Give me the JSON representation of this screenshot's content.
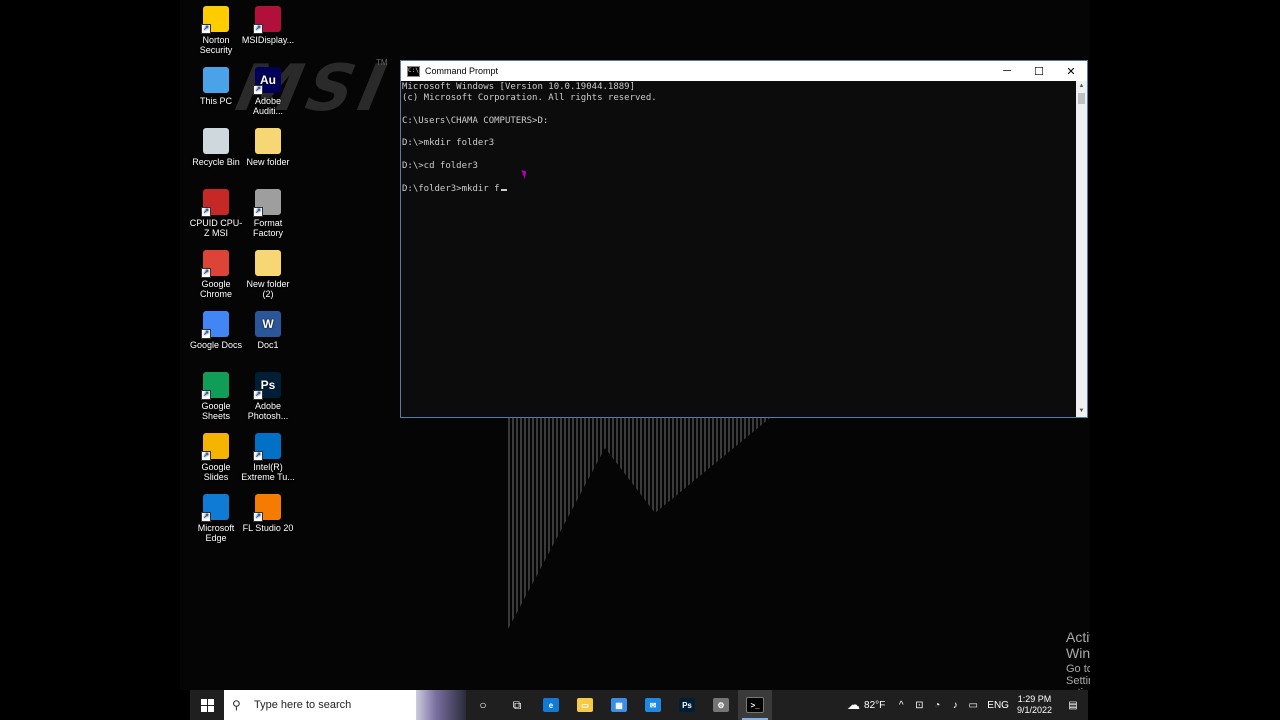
{
  "desktop": {
    "icons": [
      {
        "label": "Norton Security",
        "icon": "norton-icon",
        "color": "#ffcc00"
      },
      {
        "label": "MSIDisplay...",
        "icon": "msi-display-icon",
        "color": "#b0103a"
      },
      {
        "label": "This PC",
        "icon": "this-pc-icon",
        "color": "#4aa3e8"
      },
      {
        "label": "Adobe Auditi...",
        "icon": "adobe-audition-icon",
        "glyph": "Au",
        "color": "#00005b"
      },
      {
        "label": "Recycle Bin",
        "icon": "recycle-bin-icon",
        "color": "#cfd8dc"
      },
      {
        "label": "New folder",
        "icon": "folder-icon",
        "color": "#f7d774"
      },
      {
        "label": "CPUID CPU-Z MSI",
        "icon": "cpuz-icon",
        "color": "#c62828"
      },
      {
        "label": "Format Factory",
        "icon": "format-factory-icon",
        "color": "#9e9e9e"
      },
      {
        "label": "Google Chrome",
        "icon": "chrome-icon",
        "color": "#db4437"
      },
      {
        "label": "New folder (2)",
        "icon": "folder-icon",
        "color": "#f7d774"
      },
      {
        "label": "Google Docs",
        "icon": "google-docs-icon",
        "color": "#4285f4"
      },
      {
        "label": "Doc1",
        "icon": "word-doc-icon",
        "glyph": "W",
        "color": "#2b579a"
      },
      {
        "label": "Google Sheets",
        "icon": "google-sheets-icon",
        "color": "#0f9d58"
      },
      {
        "label": "Adobe Photosh...",
        "icon": "photoshop-icon",
        "glyph": "Ps",
        "color": "#001e36"
      },
      {
        "label": "Google Slides",
        "icon": "google-slides-icon",
        "color": "#f4b400"
      },
      {
        "label": "Intel(R) Extreme Tu...",
        "icon": "intel-xtu-icon",
        "color": "#0071c5"
      },
      {
        "label": "Microsoft Edge",
        "icon": "edge-icon",
        "color": "#0f7bd5"
      },
      {
        "label": "FL Studio 20",
        "icon": "fl-studio-icon",
        "color": "#f57c00"
      }
    ],
    "brand": "MSI",
    "brand_tm": "TM",
    "activate": {
      "title": "Activate Windows",
      "subtitle": "Go to Settings to activate Windows."
    }
  },
  "window": {
    "title": "Command Prompt",
    "icon": "cmd-icon",
    "controls": {
      "minimize": "─",
      "maximize": "☐",
      "close": "✕"
    },
    "console_lines": [
      "Microsoft Windows [Version 10.0.19044.1889]",
      "(c) Microsoft Corporation. All rights reserved.",
      "",
      "C:\\Users\\CHAMA COMPUTERS>D:",
      "",
      "D:\\>mkdir folder3",
      "",
      "D:\\>cd folder3",
      "",
      "D:\\folder3>mkdir f"
    ]
  },
  "taskbar": {
    "search_placeholder": "Type here to search",
    "apps": [
      {
        "name": "cortana-icon",
        "glyph": "○"
      },
      {
        "name": "task-view-icon",
        "glyph": "⧉"
      },
      {
        "name": "edge-icon",
        "glyph": "e",
        "color": "#0f7bd5"
      },
      {
        "name": "file-explorer-icon",
        "glyph": "▭",
        "color": "#f7c948"
      },
      {
        "name": "store-icon",
        "glyph": "▦",
        "color": "#3a8ee6"
      },
      {
        "name": "mail-icon",
        "glyph": "✉",
        "color": "#1e88e5"
      },
      {
        "name": "photoshop-icon",
        "glyph": "Ps",
        "color": "#001e36"
      },
      {
        "name": "format-factory-icon",
        "glyph": "⚙",
        "color": "#757575"
      },
      {
        "name": "cmd-icon",
        "glyph": ">_",
        "color": "#000000",
        "active": true
      }
    ],
    "weather": {
      "temp": "82°F",
      "icon": "cloud-icon"
    },
    "tray_icons": [
      "chevron-up-icon",
      "network-icon",
      "wifi-icon",
      "volume-icon",
      "battery-icon"
    ],
    "language": "ENG",
    "time": "1:29 PM",
    "date": "9/1/2022"
  }
}
